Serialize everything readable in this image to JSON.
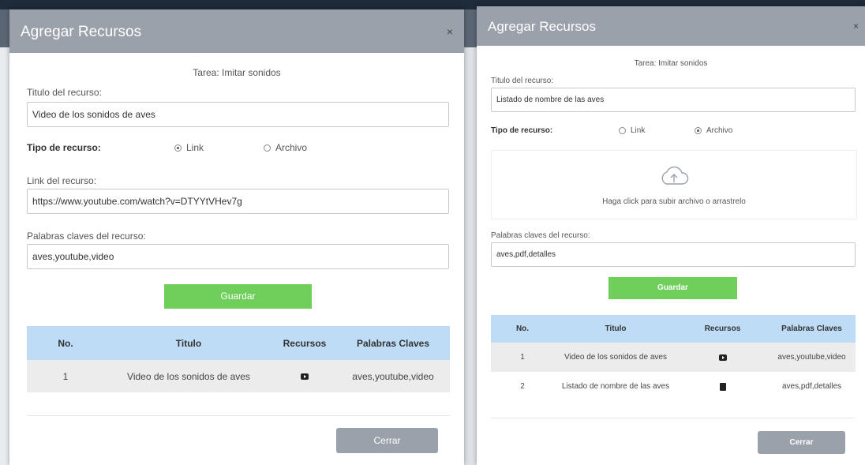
{
  "modal1": {
    "title": "Agregar Recursos",
    "close": "×",
    "task": "Tarea: Imitar sonidos",
    "title_label": "Titulo del recurso:",
    "title_value": "Video de los sonidos de aves",
    "type_label": "Tipo de recurso:",
    "radio_link": "Link",
    "radio_file": "Archivo",
    "selected_type": "Link",
    "link_label": "Link del recurso:",
    "link_value": "https://www.youtube.com/watch?v=DTYYtVHev7g",
    "keywords_label": "Palabras claves del recurso:",
    "keywords_value": "aves,youtube,video",
    "save": "Guardar",
    "table": {
      "headers": [
        "No.",
        "Titulo",
        "Recursos",
        "Palabras Claves"
      ],
      "rows": [
        {
          "no": "1",
          "title": "Video de los sonidos de aves",
          "icon": "youtube-icon",
          "keywords": "aves,youtube,video"
        }
      ]
    },
    "close_button": "Cerrar"
  },
  "modal2": {
    "title": "Agregar Recursos",
    "close": "×",
    "task": "Tarea: Imitar sonidos",
    "title_label": "Titulo del recurso:",
    "title_value": "Listado de nombre de las aves",
    "type_label": "Tipo de recurso:",
    "radio_link": "Link",
    "radio_file": "Archivo",
    "selected_type": "Archivo",
    "upload_text": "Haga click para subir archivo o arrastrelo",
    "keywords_label": "Palabras claves del recurso:",
    "keywords_value": "aves,pdf,detalles",
    "save": "Guardar",
    "table": {
      "headers": [
        "No.",
        "Titulo",
        "Recursos",
        "Palabras Claves"
      ],
      "rows": [
        {
          "no": "1",
          "title": "Video de los sonidos de aves",
          "icon": "youtube-icon",
          "keywords": "aves,youtube,video"
        },
        {
          "no": "2",
          "title": "Listado de nombre de las aves",
          "icon": "pdf-icon",
          "keywords": "aves,pdf,detalles"
        }
      ]
    },
    "close_button": "Cerrar"
  },
  "colors": {
    "header": "#9aa1ab",
    "save": "#6fcf5a",
    "table_head": "#bedcf5",
    "row_alt": "#ececec"
  }
}
